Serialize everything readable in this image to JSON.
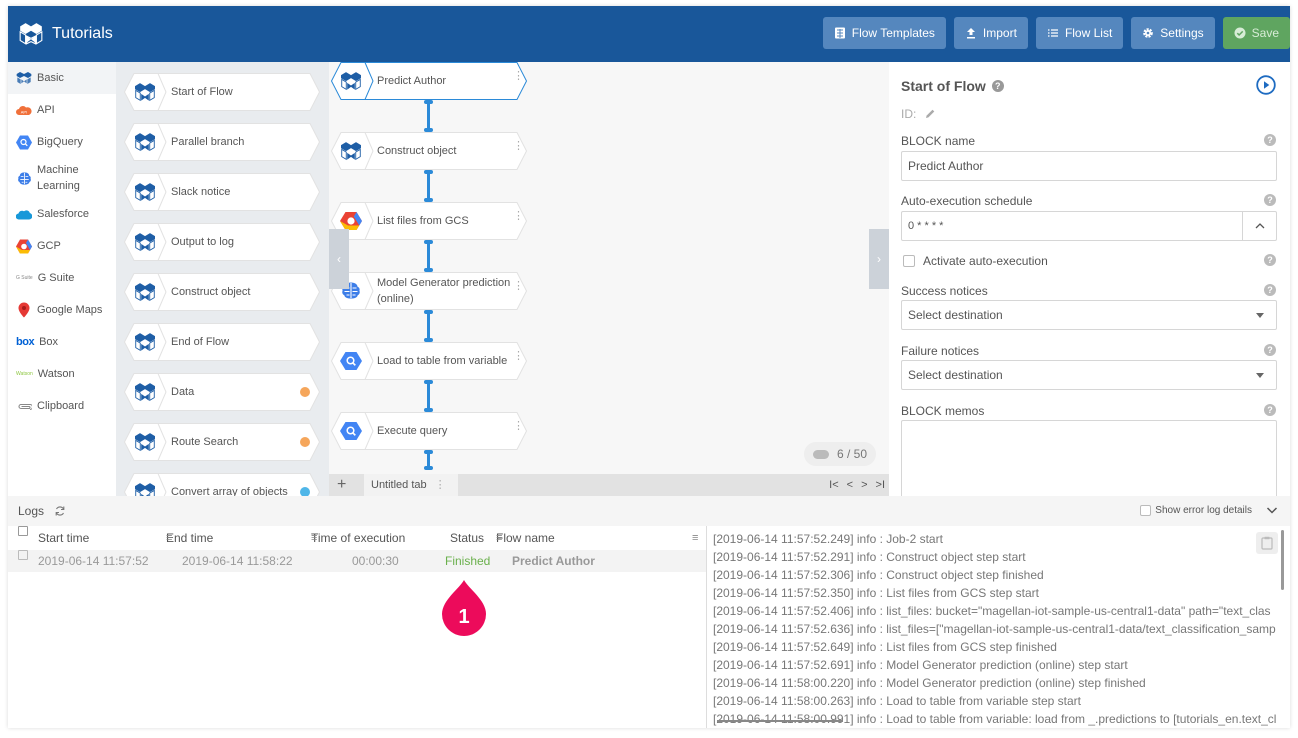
{
  "header": {
    "title": "Tutorials",
    "buttons": [
      {
        "label": "Flow Templates",
        "icon": "template-icon"
      },
      {
        "label": "Import",
        "icon": "upload-icon"
      },
      {
        "label": "Flow List",
        "icon": "list-icon"
      },
      {
        "label": "Settings",
        "icon": "gear-icon"
      },
      {
        "label": "Save",
        "icon": "check-circle-icon"
      }
    ]
  },
  "categories": [
    {
      "label": "Basic",
      "icon": "magellan-icon",
      "active": true
    },
    {
      "label": "API",
      "icon": "api-icon"
    },
    {
      "label": "BigQuery",
      "icon": "bigquery-icon"
    },
    {
      "label": "Machine Learning",
      "icon": "brain-icon"
    },
    {
      "label": "Salesforce",
      "icon": "salesforce-icon"
    },
    {
      "label": "GCP",
      "icon": "gcp-icon"
    },
    {
      "label": "G Suite",
      "icon": "gsuite-icon"
    },
    {
      "label": "Google Maps",
      "icon": "map-pin-icon"
    },
    {
      "label": "Box",
      "icon": "box-icon"
    },
    {
      "label": "Watson",
      "icon": "watson-icon"
    },
    {
      "label": "Clipboard",
      "icon": "paperclip-icon"
    }
  ],
  "palette": [
    {
      "label": "Start of Flow"
    },
    {
      "label": "Parallel branch"
    },
    {
      "label": "Slack notice"
    },
    {
      "label": "Output to log"
    },
    {
      "label": "Construct object"
    },
    {
      "label": "End of Flow"
    },
    {
      "label": "Data",
      "badge": "#f5a65b"
    },
    {
      "label": "Route Search",
      "badge": "#f5a65b"
    },
    {
      "label": "Convert array of objects",
      "badge": "#4fb6e8"
    }
  ],
  "flow": [
    {
      "label": "Predict Author",
      "icon": "magellan-icon",
      "selected": true
    },
    {
      "label": "Construct object",
      "icon": "magellan-icon"
    },
    {
      "label": "List files from GCS",
      "icon": "gcp-icon"
    },
    {
      "label": "Model Generator prediction (online)",
      "icon": "brain-icon"
    },
    {
      "label": "Load to table from variable",
      "icon": "bigquery-icon"
    },
    {
      "label": "Execute query",
      "icon": "bigquery-icon"
    }
  ],
  "canvas": {
    "counter": "6 / 50",
    "add_tab": "+",
    "tab_label": "Untitled tab",
    "pager": [
      "I<",
      "<",
      ">",
      ">I"
    ]
  },
  "properties": {
    "title": "Start of Flow",
    "id_label": "ID:",
    "block_name_label": "BLOCK name",
    "block_name_value": "Predict Author",
    "schedule_label": "Auto-execution schedule",
    "schedule_value": "0 * * * *",
    "activate_label": "Activate auto-execution",
    "success_label": "Success notices",
    "success_value": "Select destination",
    "failure_label": "Failure notices",
    "failure_value": "Select destination",
    "memo_label": "BLOCK memos"
  },
  "logs": {
    "title": "Logs",
    "show_error_label": "Show error log details",
    "columns": [
      "Start time",
      "End time",
      "Time of execution",
      "Status",
      "Flow name"
    ],
    "rows": [
      {
        "start": "2019-06-14 11:57:52",
        "end": "2019-06-14 11:58:22",
        "duration": "00:00:30",
        "status": "Finished",
        "flow": "Predict Author"
      }
    ],
    "marker": "1",
    "lines": [
      "[2019-06-14 11:57:52.249]  info : Job-2 start",
      "[2019-06-14 11:57:52.291]  info : Construct object step start",
      "[2019-06-14 11:57:52.306]  info : Construct object step finished",
      "[2019-06-14 11:57:52.350]  info : List files from GCS step start",
      "[2019-06-14 11:57:52.406]  info : list_files: bucket=\"magellan-iot-sample-us-central1-data\" path=\"text_clas",
      "[2019-06-14 11:57:52.636]  info : list_files=[\"magellan-iot-sample-us-central1-data/text_classification_samp",
      "[2019-06-14 11:57:52.649]  info : List files from GCS step finished",
      "[2019-06-14 11:57:52.691]  info : Model Generator prediction (online) step start",
      "[2019-06-14 11:58:00.220]  info : Model Generator prediction (online) step finished",
      "[2019-06-14 11:58:00.263]  info : Load to table from variable step start",
      "[2019-06-14 11:58:00.991]  info : Load to table from variable: load from _.predictions to [tutorials_en.text_cl"
    ]
  },
  "colors": {
    "header": "#19579a",
    "button": "#5587be",
    "save": "#5fa560",
    "connector": "#2b8ad8",
    "finished": "#6ab04c",
    "marker": "#ec0b5b"
  }
}
